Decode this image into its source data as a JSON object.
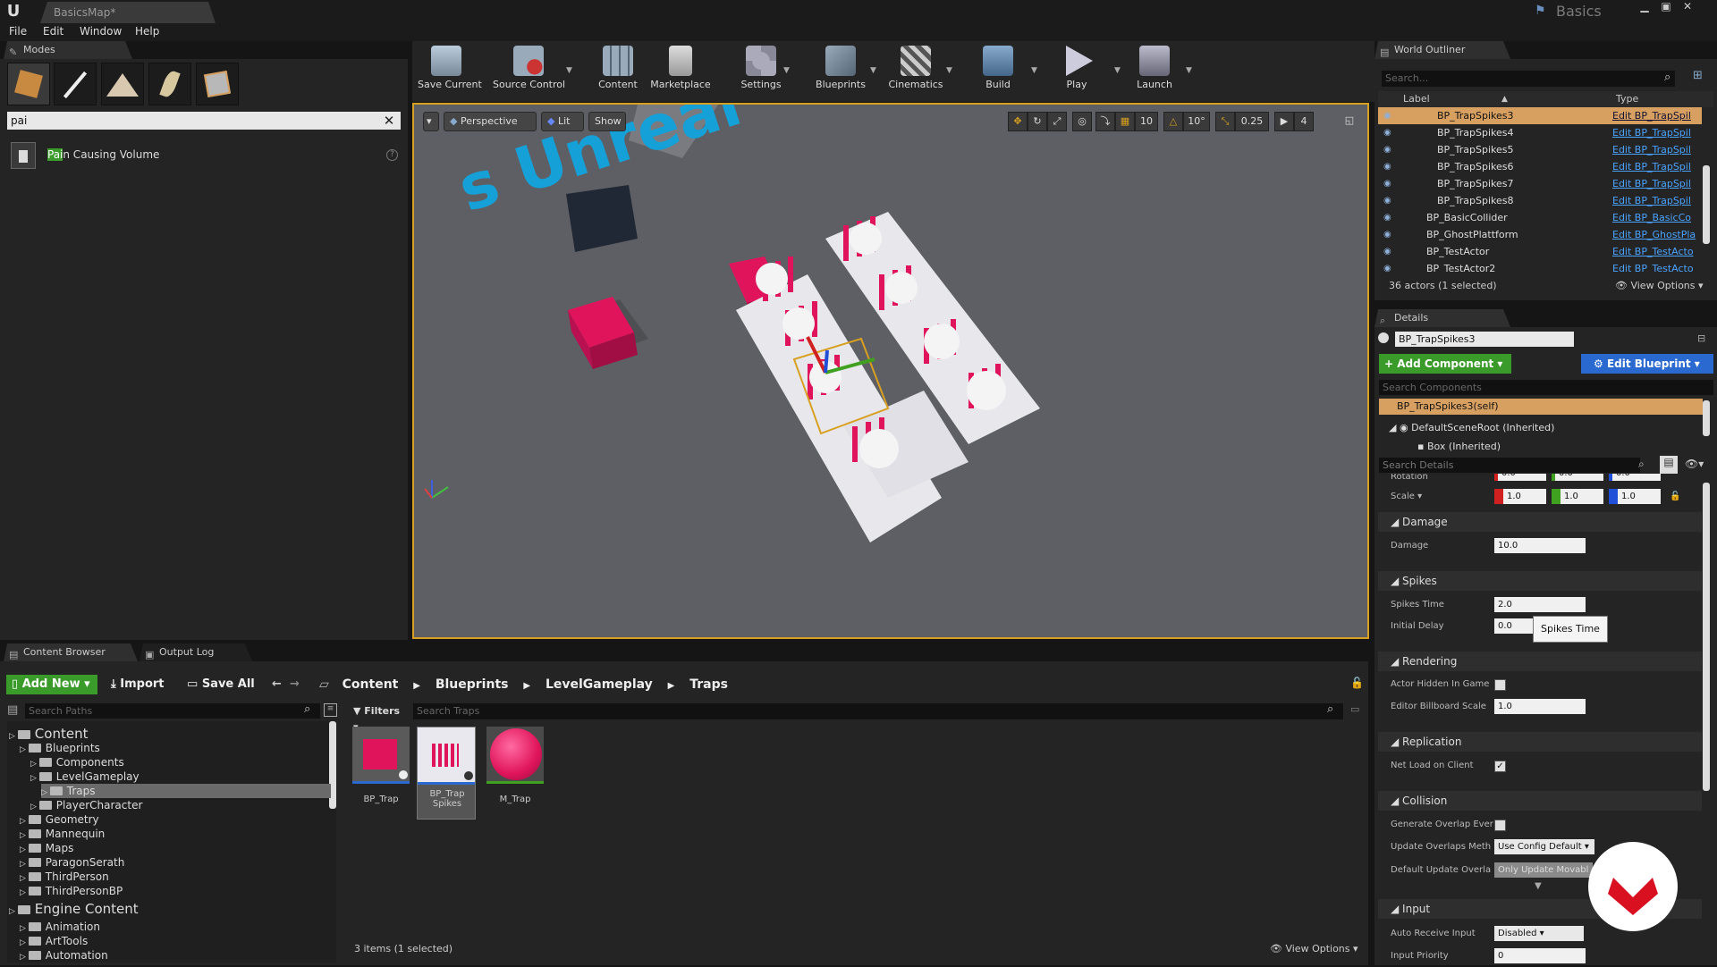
{
  "titlebar": {
    "tab_title": "BasicsMap*",
    "project": "Basics"
  },
  "menu": [
    "File",
    "Edit",
    "Window",
    "Help"
  ],
  "modes": {
    "tab_label": "Modes",
    "search_value": "pai",
    "result_highlight": "Pai",
    "result_rest": "n Causing Volume"
  },
  "toolbar": {
    "buttons": [
      {
        "label": "Save Current"
      },
      {
        "label": "Source Control"
      },
      {
        "label": "Content"
      },
      {
        "label": "Marketplace"
      },
      {
        "label": "Settings"
      },
      {
        "label": "Blueprints"
      },
      {
        "label": "Cinematics"
      },
      {
        "label": "Build"
      },
      {
        "label": "Play"
      },
      {
        "label": "Launch"
      }
    ]
  },
  "viewport": {
    "perspective_label": "Perspective",
    "lit_label": "Lit",
    "show_label": "Show",
    "grid_snap": "10",
    "rot_snap": "10°",
    "scale_snap": "0.25",
    "cam_speed": "4",
    "floor_text": "s Unreal"
  },
  "outliner": {
    "tab_label": "World Outliner",
    "search_placeholder": "Search...",
    "col_label": "Label",
    "col_type": "Type",
    "rows": [
      {
        "name": "BP_TrapSpikes3",
        "type": "Edit BP_TrapSpil",
        "selected": true
      },
      {
        "name": "BP_TrapSpikes4",
        "type": "Edit BP_TrapSpil"
      },
      {
        "name": "BP_TrapSpikes5",
        "type": "Edit BP_TrapSpil"
      },
      {
        "name": "BP_TrapSpikes6",
        "type": "Edit BP_TrapSpil"
      },
      {
        "name": "BP_TrapSpikes7",
        "type": "Edit BP_TrapSpil"
      },
      {
        "name": "BP_TrapSpikes8",
        "type": "Edit BP_TrapSpil"
      },
      {
        "name": "BP_BasicCollider",
        "type": "Edit BP_BasicCo"
      },
      {
        "name": "BP_GhostPlattform",
        "type": "Edit BP_GhostPla"
      },
      {
        "name": "BP_TestActor",
        "type": "Edit BP_TestActo"
      },
      {
        "name": "BP_TestActor2",
        "type": "Edit BP_TestActo"
      }
    ],
    "status": "36 actors (1 selected)",
    "view_options": "View Options"
  },
  "details": {
    "tab_label": "Details",
    "actor_name": "BP_TrapSpikes3",
    "add_component": "+ Add Component",
    "edit_blueprint": "Edit Blueprint",
    "search_components": "Search Components",
    "self_row": "BP_TrapSpikes3(self)",
    "root_row": "DefaultSceneRoot (Inherited)",
    "box_row": "Box (Inherited)",
    "search_details": "Search Details",
    "rotation_label": "Rotation",
    "rotation_x": "0.0",
    "rotation_y": "0.0",
    "rotation_z": "0.0",
    "scale_label": "Scale",
    "scale_x": "1.0",
    "scale_y": "1.0",
    "scale_z": "1.0",
    "damage_section": "Damage",
    "damage_label": "Damage",
    "damage_value": "10.0",
    "spikes_section": "Spikes",
    "spikes_time_label": "Spikes Time",
    "spikes_time_value": "2.0",
    "initial_delay_label": "Initial Delay",
    "initial_delay_value": "0.0",
    "tooltip": "Spikes Time",
    "rendering_section": "Rendering",
    "hidden_label": "Actor Hidden In Game",
    "billboard_label": "Editor Billboard Scale",
    "billboard_value": "1.0",
    "replication_section": "Replication",
    "netload_label": "Net Load on Client",
    "collision_section": "Collision",
    "overlap_label": "Generate Overlap Ever",
    "update_overlaps_label": "Update Overlaps Meth",
    "update_overlaps_value": "Use Config Default",
    "default_overlap_label": "Default Update Overla",
    "default_overlap_value": "Only Update Movabl",
    "input_section": "Input",
    "auto_receive_label": "Auto Receive Input",
    "auto_receive_value": "Disabled",
    "input_priority_label": "Input Priority",
    "input_priority_value": "0"
  },
  "content_browser": {
    "tab_label": "Content Browser",
    "output_tab": "Output Log",
    "add_new": "Add New",
    "import": "Import",
    "save_all": "Save All",
    "breadcrumbs": [
      "Content",
      "Blueprints",
      "LevelGameplay",
      "Traps"
    ],
    "search_paths": "Search Paths",
    "filters": "Filters",
    "search_assets": "Search Traps",
    "tree": [
      {
        "label": "Content",
        "level": 0,
        "root": true
      },
      {
        "label": "Blueprints",
        "level": 1
      },
      {
        "label": "Components",
        "level": 2
      },
      {
        "label": "LevelGameplay",
        "level": 2
      },
      {
        "label": "Traps",
        "level": 3,
        "selected": true
      },
      {
        "label": "PlayerCharacter",
        "level": 2
      },
      {
        "label": "Geometry",
        "level": 1
      },
      {
        "label": "Mannequin",
        "level": 1
      },
      {
        "label": "Maps",
        "level": 1
      },
      {
        "label": "ParagonSerath",
        "level": 1
      },
      {
        "label": "ThirdPerson",
        "level": 1
      },
      {
        "label": "ThirdPersonBP",
        "level": 1
      },
      {
        "label": "Engine Content",
        "level": 0,
        "root": true
      },
      {
        "label": "Animation",
        "level": 1
      },
      {
        "label": "ArtTools",
        "level": 1
      },
      {
        "label": "Automation",
        "level": 1
      }
    ],
    "assets": [
      {
        "label": "BP_Trap"
      },
      {
        "label": "BP_Trap Spikes"
      },
      {
        "label": "M_Trap"
      }
    ],
    "status": "3 items (1 selected)",
    "view_options": "View Options"
  },
  "colors": {
    "accent": "#d8a020",
    "trap_pink": "#e0145a",
    "add_green": "#3a9a2a",
    "link_blue": "#4aa3ff"
  }
}
